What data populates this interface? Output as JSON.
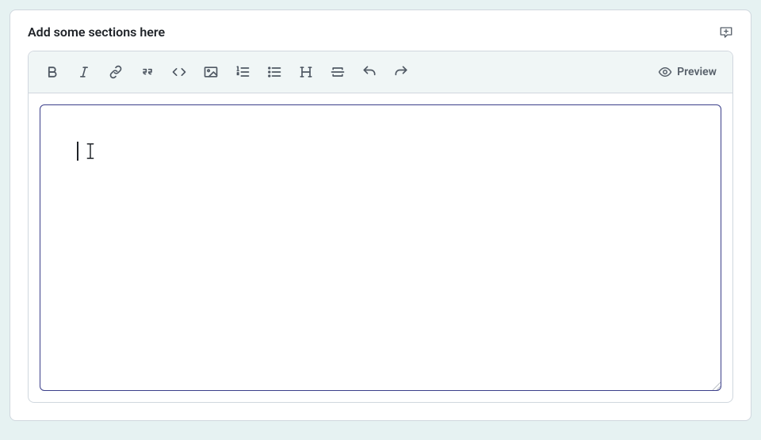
{
  "header": {
    "title": "Add some sections here"
  },
  "toolbar": {
    "icons": {
      "bold": "bold-icon",
      "italic": "italic-icon",
      "link": "link-icon",
      "quote": "quote-icon",
      "code": "code-icon",
      "image": "image-icon",
      "ordered_list": "ordered-list-icon",
      "unordered_list": "unordered-list-icon",
      "heading": "heading-icon",
      "section": "section-break-icon",
      "undo": "undo-icon",
      "redo": "redo-icon"
    },
    "preview_label": "Preview"
  },
  "editor": {
    "value": "",
    "placeholder": ""
  }
}
